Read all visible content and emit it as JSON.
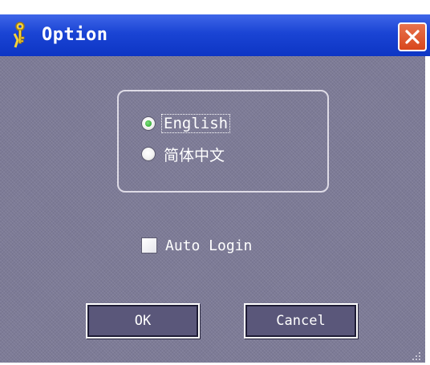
{
  "window": {
    "title": "Option",
    "title_icon": "keys-icon",
    "close_icon": "close-icon"
  },
  "language_group": {
    "options": [
      {
        "label": "English",
        "selected": true
      },
      {
        "label": "简体中文",
        "selected": false
      }
    ]
  },
  "auto_login": {
    "label": "Auto Login",
    "checked": false
  },
  "buttons": {
    "ok_label": "OK",
    "cancel_label": "Cancel"
  },
  "colors": {
    "titlebar": "#1a44d4",
    "body": "#7d7b97",
    "close_button": "#d8461c",
    "radio_selected": "#1f9b1f"
  }
}
